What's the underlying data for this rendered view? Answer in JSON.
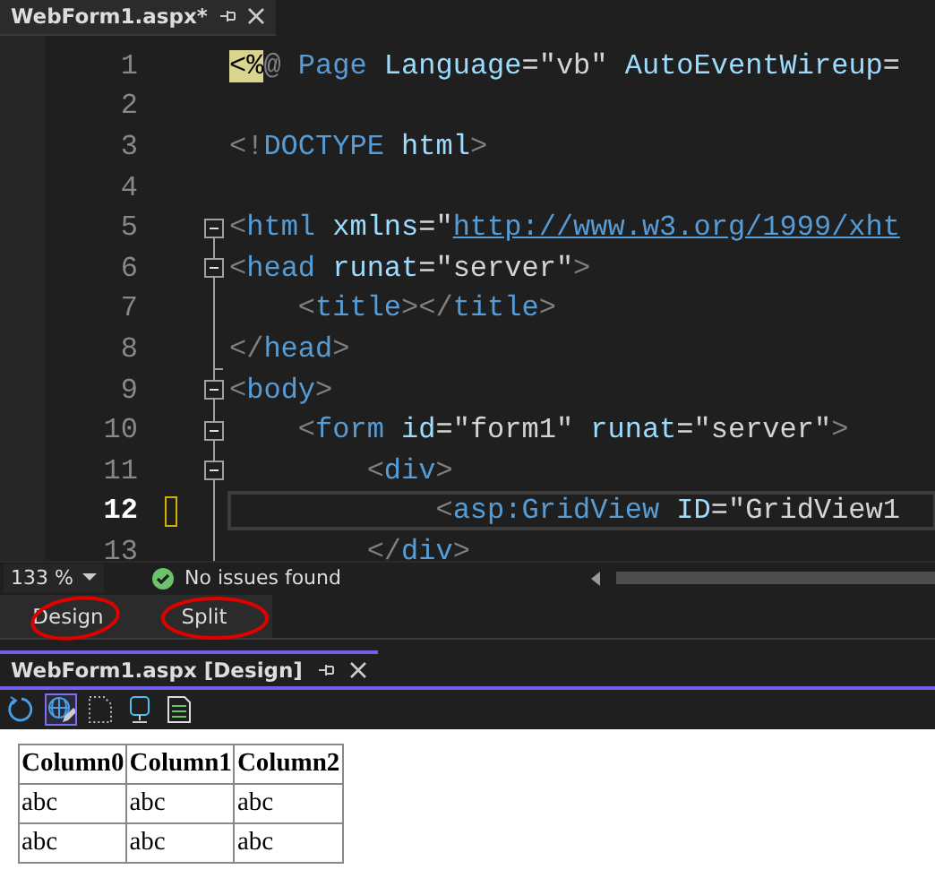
{
  "editor_tab": {
    "title": "WebForm1.aspx*"
  },
  "code_lines": [
    {
      "number": "1",
      "kind": "plain",
      "current": false,
      "segments": [
        {
          "kind": "directive",
          "text": "<%"
        },
        {
          "kind": "punct",
          "text": "@"
        },
        {
          "kind": "tag",
          "text": " Page"
        },
        {
          "kind": "attr",
          "text": " Language"
        },
        {
          "kind": "value",
          "text": "=\"vb\""
        },
        {
          "kind": "attr",
          "text": " AutoEventWireup"
        },
        {
          "kind": "value",
          "text": "="
        }
      ]
    },
    {
      "number": "2",
      "kind": "plain",
      "current": false
    },
    {
      "number": "3",
      "kind": "plain",
      "current": false,
      "segments": [
        {
          "kind": "punct",
          "text": "<!"
        },
        {
          "kind": "tag",
          "text": "DOCTYPE"
        },
        {
          "kind": "attr",
          "text": " html"
        },
        {
          "kind": "punct",
          "text": ">"
        }
      ]
    },
    {
      "number": "4",
      "kind": "plain",
      "current": false
    },
    {
      "number": "5",
      "kind": "fold-start",
      "current": false,
      "segments": [
        {
          "kind": "punct",
          "text": "<"
        },
        {
          "kind": "tag",
          "text": "html"
        },
        {
          "kind": "attr",
          "text": " xmlns"
        },
        {
          "kind": "value",
          "text": "=\""
        },
        {
          "kind": "link",
          "text": "http://www.w3.org/1999/xht"
        }
      ]
    },
    {
      "number": "6",
      "kind": "fold-start",
      "current": false,
      "segments": [
        {
          "kind": "punct",
          "text": "<"
        },
        {
          "kind": "tag",
          "text": "head"
        },
        {
          "kind": "attr",
          "text": " runat"
        },
        {
          "kind": "value",
          "text": "=\"server\""
        },
        {
          "kind": "punct",
          "text": ">"
        }
      ]
    },
    {
      "number": "7",
      "kind": "fold-line",
      "current": false,
      "segments": [
        {
          "kind": "punct",
          "text": "    <"
        },
        {
          "kind": "tag",
          "text": "title"
        },
        {
          "kind": "punct",
          "text": "></"
        },
        {
          "kind": "tag",
          "text": "title"
        },
        {
          "kind": "punct",
          "text": ">"
        }
      ]
    },
    {
      "number": "8",
      "kind": "fold-end",
      "current": false,
      "segments": [
        {
          "kind": "punct",
          "text": "</"
        },
        {
          "kind": "tag",
          "text": "head"
        },
        {
          "kind": "punct",
          "text": ">"
        }
      ]
    },
    {
      "number": "9",
      "kind": "fold-start",
      "current": false,
      "segments": [
        {
          "kind": "punct",
          "text": "<"
        },
        {
          "kind": "tag",
          "text": "body"
        },
        {
          "kind": "punct",
          "text": ">"
        }
      ]
    },
    {
      "number": "10",
      "kind": "fold-start",
      "current": false,
      "segments": [
        {
          "kind": "punct",
          "text": "    <"
        },
        {
          "kind": "tag",
          "text": "form"
        },
        {
          "kind": "attr",
          "text": " id"
        },
        {
          "kind": "value",
          "text": "=\"form1\""
        },
        {
          "kind": "attr",
          "text": " runat"
        },
        {
          "kind": "value",
          "text": "=\"server\""
        },
        {
          "kind": "punct",
          "text": ">"
        }
      ]
    },
    {
      "number": "11",
      "kind": "fold-start",
      "current": false,
      "segments": [
        {
          "kind": "punct",
          "text": "        <"
        },
        {
          "kind": "tag",
          "text": "div"
        },
        {
          "kind": "punct",
          "text": ">"
        }
      ]
    },
    {
      "number": "12",
      "kind": "fold-line",
      "current": true,
      "segments": [
        {
          "kind": "punct",
          "text": "            <"
        },
        {
          "kind": "tag",
          "text": "asp:GridView"
        },
        {
          "kind": "attr",
          "text": " ID"
        },
        {
          "kind": "value",
          "text": "=\"GridView1"
        }
      ]
    },
    {
      "number": "13",
      "kind": "fold-line",
      "current": false,
      "segments": [
        {
          "kind": "punct",
          "text": "        </"
        },
        {
          "kind": "tag",
          "text": "div"
        },
        {
          "kind": "punct",
          "text": ">"
        }
      ]
    }
  ],
  "status_bar": {
    "zoom": "133 %",
    "issues": "No issues found"
  },
  "view_buttons": [
    "Design",
    "Split"
  ],
  "design_tab": {
    "title": "WebForm1.aspx [Design]"
  },
  "toolbar": [
    {
      "kind": "refresh",
      "selected": false
    },
    {
      "kind": "globe-edit",
      "selected": true
    },
    {
      "kind": "dotted-page",
      "selected": false
    },
    {
      "kind": "monitor",
      "selected": false
    },
    {
      "kind": "document",
      "selected": false
    }
  ],
  "grid": {
    "columns": [
      "Column0",
      "Column1",
      "Column2"
    ],
    "rows": [
      [
        "abc",
        "abc",
        "abc"
      ],
      [
        "abc",
        "abc",
        "abc"
      ]
    ]
  }
}
